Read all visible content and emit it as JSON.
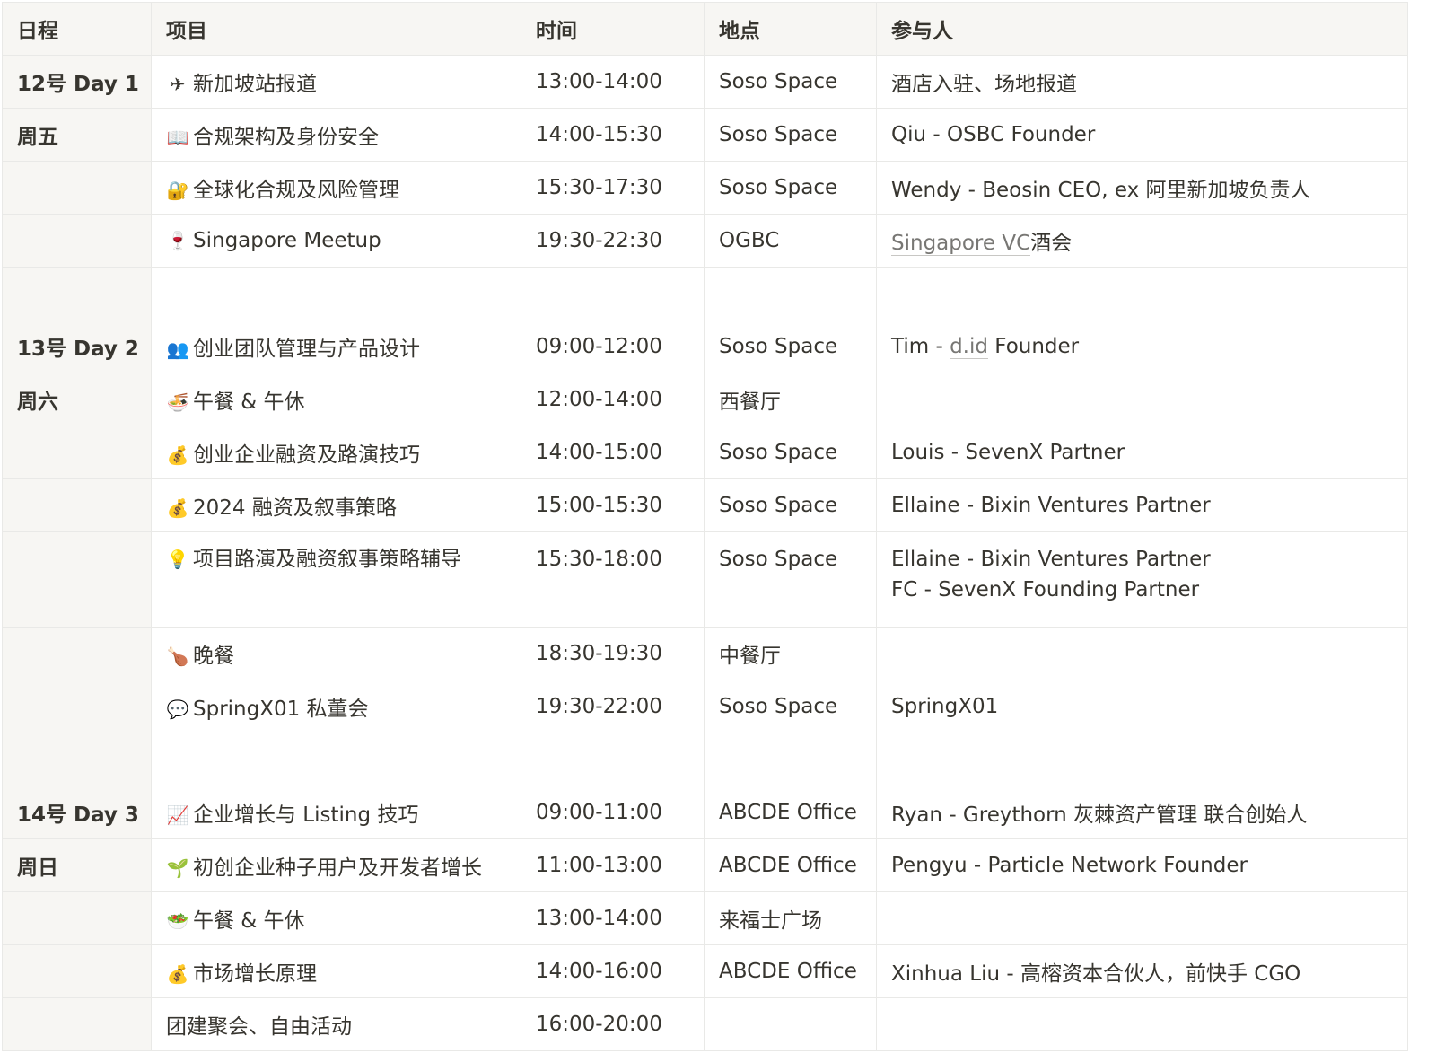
{
  "headers": [
    "日程",
    "项目",
    "时间",
    "地点",
    "参与人"
  ],
  "rows": [
    {
      "day": "12号 Day 1",
      "icon": "✈",
      "icon_name": "airplane-icon",
      "item": "新加坡站报道",
      "time": "13:00-14:00",
      "place": "Soso Space",
      "people": "酒店入驻、场地报道"
    },
    {
      "day": "周五",
      "icon": "📖",
      "icon_name": "book-icon",
      "item": "合规架构及身份安全",
      "time": "14:00-15:30",
      "place": "Soso Space",
      "people": "Qiu - OSBC Founder"
    },
    {
      "day": "",
      "icon": "🔐",
      "icon_name": "lock-key-icon",
      "item": "全球化合规及风险管理",
      "time": "15:30-17:30",
      "place": "Soso Space",
      "people": "Wendy - Beosin CEO, ex 阿里新加坡负责人"
    },
    {
      "day": "",
      "icon": "🍷",
      "icon_name": "wine-glass-icon",
      "item": "Singapore Meetup",
      "time": "19:30-22:30",
      "place": "OGBC",
      "people_link": "Singapore VC",
      "people_suffix": "酒会"
    },
    {
      "blank": true
    },
    {
      "day": "13号 Day 2",
      "icon": "👥",
      "icon_name": "people-icon",
      "item": "创业团队管理与产品设计",
      "time": "09:00-12:00",
      "place": "Soso Space",
      "people_prefix": "Tim - ",
      "people_link": "d.id",
      "people_suffix": " Founder"
    },
    {
      "day": "周六",
      "icon": "🍜",
      "icon_name": "noodle-bowl-icon",
      "item": "午餐 & 午休",
      "time": "12:00-14:00",
      "place": "西餐厅",
      "people": ""
    },
    {
      "day": "",
      "icon": "💰",
      "icon_name": "money-bag-icon",
      "item": "创业企业融资及路演技巧",
      "time": "14:00-15:00",
      "place": "Soso Space",
      "people": "Louis - SevenX Partner"
    },
    {
      "day": "",
      "icon": "💰",
      "icon_name": "money-bag-icon",
      "item": "2024 融资及叙事策略",
      "time": "15:00-15:30",
      "place": "Soso Space",
      "people": "Ellaine - Bixin Ventures Partner"
    },
    {
      "day": "",
      "icon": "💡",
      "icon_name": "light-bulb-icon",
      "item": "项目路演及融资叙事策略辅导",
      "time": "15:30-18:00",
      "place": "Soso Space",
      "people_lines": [
        "Ellaine - Bixin Ventures Partner",
        "FC - SevenX Founding Partner"
      ]
    },
    {
      "day": "",
      "icon": "🍗",
      "icon_name": "drumstick-icon",
      "item": "晚餐",
      "time": "18:30-19:30",
      "place": "中餐厅",
      "people": ""
    },
    {
      "day": "",
      "icon": "💬",
      "icon_name": "speech-bubble-icon",
      "item": "SpringX01 私董会",
      "time": "19:30-22:00",
      "place": "Soso Space",
      "people": "SpringX01"
    },
    {
      "blank": true
    },
    {
      "day": "14号 Day 3",
      "icon": "📈",
      "icon_name": "chart-increasing-icon",
      "item": "企业增长与 Listing 技巧",
      "time": "09:00-11:00",
      "place": "ABCDE Office",
      "people": "Ryan - Greythorn 灰棘资产管理 联合创始人"
    },
    {
      "day": "周日",
      "icon": "🌱",
      "icon_name": "seedling-icon",
      "item": "初创企业种子用户及开发者增长",
      "time": "11:00-13:00",
      "place": "ABCDE Office",
      "people": "Pengyu - Particle Network Founder"
    },
    {
      "day": "",
      "icon": "🥗",
      "icon_name": "salad-icon",
      "item": "午餐 & 午休",
      "time": "13:00-14:00",
      "place": "来福士广场",
      "people": ""
    },
    {
      "day": "",
      "icon": "💰",
      "icon_name": "money-bag-icon",
      "item": "市场增长原理",
      "time": "14:00-16:00",
      "place": "ABCDE Office",
      "people": "Xinhua Liu - 高榕资本合伙人，前快手 CGO"
    },
    {
      "day": "",
      "icon": "",
      "icon_name": "",
      "item": "团建聚会、自由活动",
      "time": "16:00-20:00",
      "place": "",
      "people": ""
    }
  ]
}
